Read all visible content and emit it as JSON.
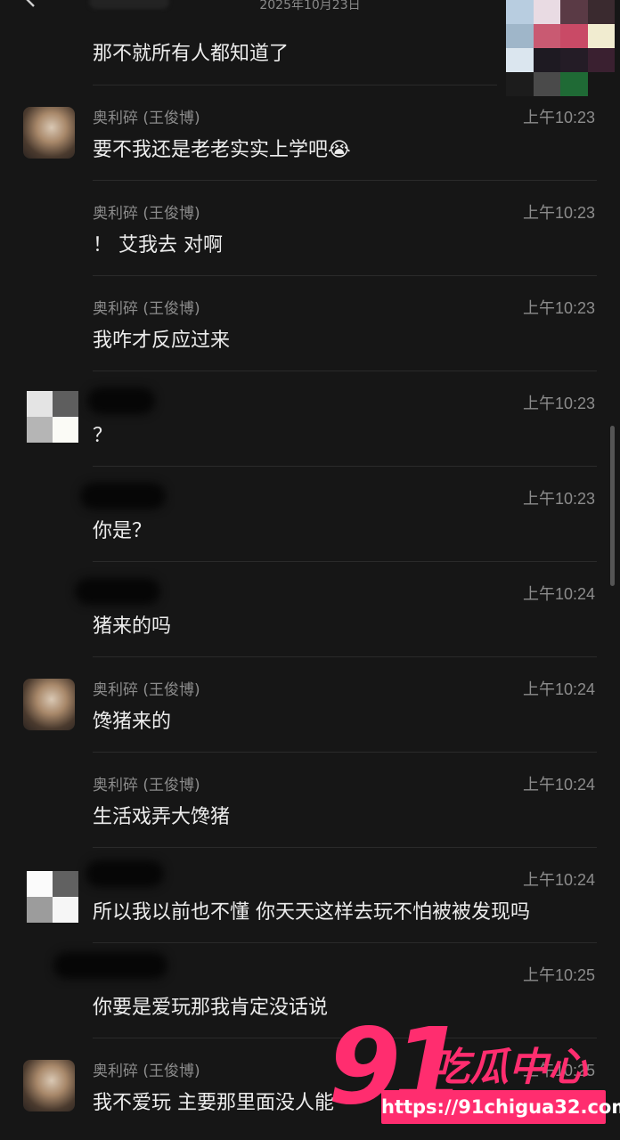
{
  "header": {
    "date": "2025年10月23日",
    "back_icon": "chevron-left-icon",
    "more_icon": "more-dots-icon"
  },
  "messages": [
    {
      "sender": "",
      "time": "",
      "text": "那不就所有人都知道了"
    },
    {
      "sender": "奥利碎 (王俊博)",
      "time": "上午10:23",
      "text": "要不我还是老老实实上学吧😭"
    },
    {
      "sender": "奥利碎 (王俊博)",
      "time": "上午10:23",
      "text": "！ 艾我去 对啊"
    },
    {
      "sender": "奥利碎 (王俊博)",
      "time": "上午10:23",
      "text": "我咋才反应过来"
    },
    {
      "sender": "",
      "time": "上午10:23",
      "text": "？"
    },
    {
      "sender": "",
      "time": "上午10:23",
      "text": "你是？"
    },
    {
      "sender": "",
      "time": "上午10:24",
      "text": "猪来的吗"
    },
    {
      "sender": "奥利碎 (王俊博)",
      "time": "上午10:24",
      "text": "馋猪来的"
    },
    {
      "sender": "奥利碎 (王俊博)",
      "time": "上午10:24",
      "text": "生活戏弄大馋猪"
    },
    {
      "sender": "",
      "time": "上午10:24",
      "text": "所以我以前也不懂 你天天这样去玩不怕被被发现吗"
    },
    {
      "sender": "",
      "time": "上午10:25",
      "text": "你要是爱玩那我肯定没话说"
    },
    {
      "sender": "奥利碎 (王俊博)",
      "time": "上午10:25",
      "text": "我不爱玩 主要那里面没人能"
    }
  ],
  "watermark": {
    "logo_number": "91",
    "logo_text": "吃瓜中心",
    "url": "https://91chigua32.com"
  },
  "colors": {
    "background": "#161616",
    "watermark_pink": "#ff2d6f",
    "muted_text": "#8c8c8c"
  }
}
